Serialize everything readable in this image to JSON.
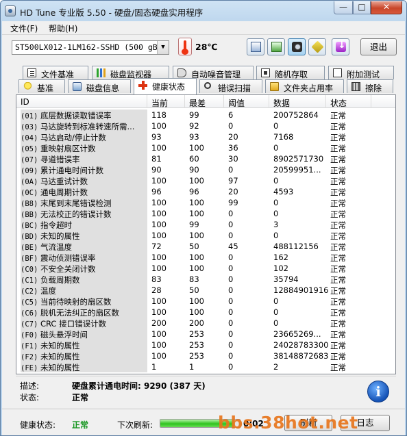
{
  "window": {
    "title": "HD Tune 专业版 5.50 - 硬盘/固态硬盘实用程序",
    "min_label": "—",
    "max_label": "□",
    "close_label": "✕"
  },
  "menu": [
    {
      "label": "文件(F)"
    },
    {
      "label": "帮助(H)"
    }
  ],
  "toolbar": {
    "drive": "ST500LX012-1LM162-SSHD (500 gB)",
    "temperature": "28℃",
    "icons": [
      "copy-text-icon",
      "copy-screen-icon",
      "screenshot-camera-icon",
      "options-tool-icon",
      "save-down-icon"
    ],
    "exit_label": "退出"
  },
  "tabs_row1": [
    {
      "label": "文件基准",
      "icon": "file-benchmark-icon"
    },
    {
      "label": "磁盘监视器",
      "icon": "disk-monitor-icon"
    },
    {
      "label": "自动噪音管理",
      "icon": "aam-speaker-icon"
    },
    {
      "label": "随机存取",
      "icon": "random-access-icon"
    },
    {
      "label": "附加测试",
      "icon": "extra-tests-icon"
    }
  ],
  "tabs_row2": [
    {
      "label": "基准",
      "icon": "benchmark-bulb-icon"
    },
    {
      "label": "磁盘信息",
      "icon": "disk-info-icon"
    },
    {
      "label": "健康状态",
      "icon": "health-cross-icon"
    },
    {
      "label": "错误扫描",
      "icon": "error-scan-icon"
    },
    {
      "label": "文件夹占用率",
      "icon": "folder-usage-icon"
    },
    {
      "label": "擦除",
      "icon": "erase-trash-icon"
    }
  ],
  "table": {
    "columns": [
      "ID",
      "当前",
      "最差",
      "阈值",
      "数据",
      "状态"
    ],
    "rows": [
      {
        "code": "(01)",
        "name": "底层数据读取错误率",
        "current": "118",
        "worst": "99",
        "threshold": "6",
        "data": "200752864",
        "status": "正常"
      },
      {
        "code": "(03)",
        "name": "马达旋转到标准转速所需...",
        "current": "100",
        "worst": "92",
        "threshold": "0",
        "data": "0",
        "status": "正常"
      },
      {
        "code": "(04)",
        "name": "马达启动/停止计数",
        "current": "93",
        "worst": "93",
        "threshold": "20",
        "data": "7168",
        "status": "正常"
      },
      {
        "code": "(05)",
        "name": "重映射扇区计数",
        "current": "100",
        "worst": "100",
        "threshold": "36",
        "data": "0",
        "status": "正常"
      },
      {
        "code": "(07)",
        "name": "寻道错误率",
        "current": "81",
        "worst": "60",
        "threshold": "30",
        "data": "8902571730",
        "status": "正常"
      },
      {
        "code": "(09)",
        "name": "累计通电时间计数",
        "current": "90",
        "worst": "90",
        "threshold": "0",
        "data": "20599951...",
        "status": "正常"
      },
      {
        "code": "(0A)",
        "name": "马达重试计数",
        "current": "100",
        "worst": "100",
        "threshold": "97",
        "data": "0",
        "status": "正常"
      },
      {
        "code": "(0C)",
        "name": "通电周期计数",
        "current": "96",
        "worst": "96",
        "threshold": "20",
        "data": "4593",
        "status": "正常"
      },
      {
        "code": "(B8)",
        "name": "末尾到末尾错误检测",
        "current": "100",
        "worst": "100",
        "threshold": "99",
        "data": "0",
        "status": "正常"
      },
      {
        "code": "(BB)",
        "name": "无法校正的错误计数",
        "current": "100",
        "worst": "100",
        "threshold": "0",
        "data": "0",
        "status": "正常"
      },
      {
        "code": "(BC)",
        "name": "指令超时",
        "current": "100",
        "worst": "99",
        "threshold": "0",
        "data": "3",
        "status": "正常"
      },
      {
        "code": "(BD)",
        "name": "未知的属性",
        "current": "100",
        "worst": "100",
        "threshold": "0",
        "data": "0",
        "status": "正常"
      },
      {
        "code": "(BE)",
        "name": "气流温度",
        "current": "72",
        "worst": "50",
        "threshold": "45",
        "data": "488112156",
        "status": "正常"
      },
      {
        "code": "(BF)",
        "name": "震动侦测错误率",
        "current": "100",
        "worst": "100",
        "threshold": "0",
        "data": "162",
        "status": "正常"
      },
      {
        "code": "(C0)",
        "name": "不安全关闭计数",
        "current": "100",
        "worst": "100",
        "threshold": "0",
        "data": "102",
        "status": "正常"
      },
      {
        "code": "(C1)",
        "name": "负载周期数",
        "current": "83",
        "worst": "83",
        "threshold": "0",
        "data": "35794",
        "status": "正常"
      },
      {
        "code": "(C2)",
        "name": "温度",
        "current": "28",
        "worst": "50",
        "threshold": "0",
        "data": "12884901916",
        "status": "正常"
      },
      {
        "code": "(C5)",
        "name": "当前待映射的扇区数",
        "current": "100",
        "worst": "100",
        "threshold": "0",
        "data": "0",
        "status": "正常"
      },
      {
        "code": "(C6)",
        "name": "脱机无法纠正的扇区数",
        "current": "100",
        "worst": "100",
        "threshold": "0",
        "data": "0",
        "status": "正常"
      },
      {
        "code": "(C7)",
        "name": "CRC 接口错误计数",
        "current": "200",
        "worst": "200",
        "threshold": "0",
        "data": "0",
        "status": "正常"
      },
      {
        "code": "(F0)",
        "name": "磁头悬浮时间",
        "current": "100",
        "worst": "253",
        "threshold": "0",
        "data": "23665269...",
        "status": "正常"
      },
      {
        "code": "(F1)",
        "name": "未知的属性",
        "current": "100",
        "worst": "253",
        "threshold": "0",
        "data": "24028783300",
        "status": "正常"
      },
      {
        "code": "(F2)",
        "name": "未知的属性",
        "current": "100",
        "worst": "253",
        "threshold": "0",
        "data": "38148872683",
        "status": "正常"
      },
      {
        "code": "(FE)",
        "name": "未知的属性",
        "current": "1",
        "worst": "1",
        "threshold": "0",
        "data": "2",
        "status": "正常"
      }
    ]
  },
  "details": {
    "desc_label": "描述:",
    "desc_value": "硬盘累计通电时间: 9290 (387 天)",
    "state_label": "状态:",
    "state_value": "正常"
  },
  "status_bar": {
    "health_label": "健康状态:",
    "health_value": "正常",
    "refresh_label": "下次刷新:",
    "refresh_progress": 0.92,
    "refresh_timer": "0:02",
    "refresh_button": "刷新",
    "log_button": "日志"
  },
  "watermark": "bbs.38hot.net",
  "colors": {
    "ok_green": "#14951e",
    "progress_green": "#2fc31e",
    "watermark_orange": "#e8761d"
  }
}
